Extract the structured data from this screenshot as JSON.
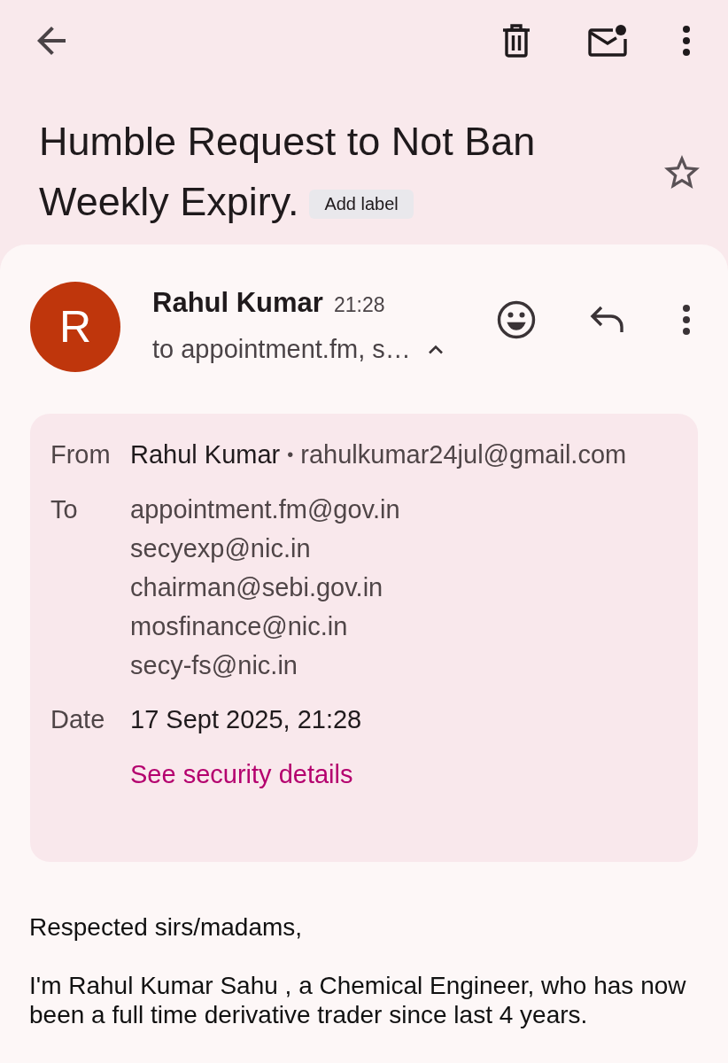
{
  "subject": {
    "title_lines": [
      "Humble Request to Not Ban",
      "Weekly Expiry."
    ],
    "label_chip": "Add label",
    "starred": false
  },
  "message": {
    "avatar_initial": "R",
    "sender": "Rahul Kumar",
    "time": "21:28",
    "recipients_summary": "to appointment.fm, s…",
    "expanded": true,
    "details": {
      "from": {
        "label": "From",
        "name": "Rahul Kumar",
        "separator": "•",
        "email": "rahulkumar24jul@gmail.com"
      },
      "to": {
        "label": "To",
        "addresses": [
          "appointment.fm@gov.in",
          "secyexp@nic.in",
          "chairman@sebi.gov.in",
          "mosfinance@nic.in",
          "secy-fs@nic.in"
        ]
      },
      "date": {
        "label": "Date",
        "value": "17 Sept 2025, 21:28"
      },
      "security_link": "See security details"
    }
  },
  "body": {
    "paragraphs": [
      "Respected sirs/madams,",
      "I'm Rahul Kumar Sahu , a Chemical Engineer, who has now been a full time derivative trader since last 4 years."
    ]
  }
}
